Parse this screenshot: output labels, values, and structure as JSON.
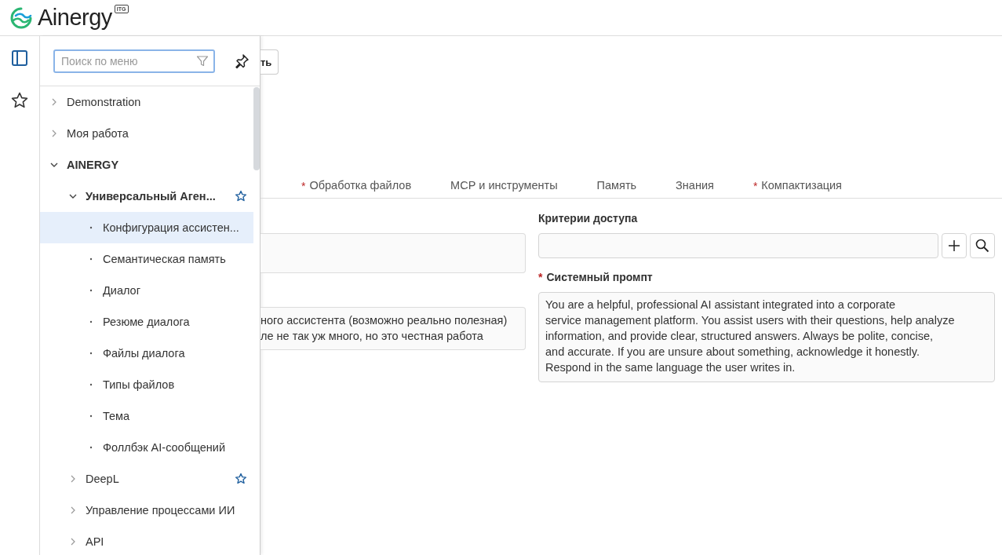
{
  "header": {
    "logo_text": "Ainergy",
    "logo_badge": "ITG"
  },
  "rail": {
    "items": [
      {
        "kind": "panel",
        "selected": true
      },
      {
        "kind": "favorites",
        "selected": false
      }
    ]
  },
  "menu": {
    "search": {
      "placeholder": "Поиск по меню"
    },
    "tree": [
      {
        "label": "Demonstration",
        "expanded": false,
        "selected": false,
        "favorite": false
      },
      {
        "label": "Моя работа",
        "expanded": false,
        "selected": false,
        "favorite": false
      },
      {
        "label": "AINERGY",
        "expanded": true,
        "selected": false,
        "favorite": false,
        "children": [
          {
            "label": "Универсальный Аген...",
            "expanded": true,
            "selected": false,
            "favorite": true,
            "children": [
              {
                "label": "Конфигурация ассистен...",
                "selected": true,
                "favorite": false
              },
              {
                "label": "Семантическая память",
                "selected": false,
                "favorite": false
              },
              {
                "label": "Диалог",
                "selected": false,
                "favorite": false
              },
              {
                "label": "Резюме диалога",
                "selected": false,
                "favorite": false
              },
              {
                "label": "Файлы диалога",
                "selected": false,
                "favorite": false
              },
              {
                "label": "Типы файлов",
                "selected": false,
                "favorite": false
              },
              {
                "label": "Тема",
                "selected": false,
                "favorite": false
              },
              {
                "label": "Фоллбэк AI-сообщений",
                "selected": false,
                "favorite": false
              }
            ]
          },
          {
            "label": "DeepL",
            "expanded": false,
            "selected": false,
            "favorite": true
          },
          {
            "label": "Управление процессами ИИ",
            "expanded": false,
            "selected": false,
            "favorite": false
          },
          {
            "label": "API",
            "expanded": false,
            "selected": false,
            "favorite": false
          }
        ]
      }
    ]
  },
  "toolbar": {
    "button_fragment": "ть"
  },
  "tabs": [
    {
      "label": "Обработка файлов",
      "required": true,
      "selected": false
    },
    {
      "label": "МСР и инструменты",
      "required": false,
      "selected": false
    },
    {
      "label": "Память",
      "required": false,
      "selected": false
    },
    {
      "label": "Знания",
      "required": false,
      "selected": false
    },
    {
      "label": "Компактизация",
      "required": true,
      "selected": false
    }
  ],
  "required_mark": "*",
  "left_fields": [
    {
      "kind": "blank"
    },
    {
      "kind": "text",
      "value": "ного ассистента (возможно реально полезная)\nле не так уж много, но это честная работа"
    }
  ],
  "access_criteria": {
    "label": "Критерии доступа",
    "required": false
  },
  "system_prompt": {
    "label": "Системный промпт",
    "required": true,
    "value": "You are a helpful, professional AI assistant integrated into a corporate\nservice management platform. You assist users with their questions, help analyze\ninformation, and provide clear, structured answers. Always be polite, concise,\nand accurate. If you are unsure about something, acknowledge it honestly.\nRespond in the same language the user writes in."
  }
}
